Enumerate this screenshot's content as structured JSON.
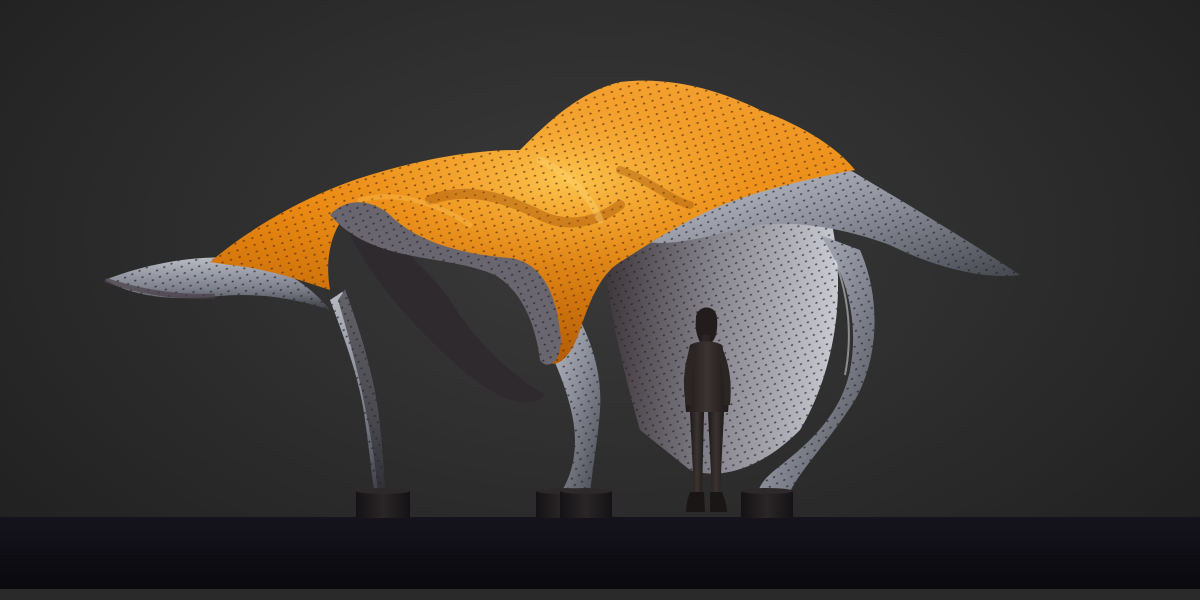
{
  "scene": {
    "subject": "sculpture-render",
    "colors": {
      "background": "#2e2e2e",
      "ground": "#0e0d14",
      "canopy_orange": "#e8860f",
      "canopy_highlight": "#f7a93a",
      "canopy_shadow": "#a85608",
      "metal_light": "#a9acb6",
      "metal_dark": "#4b4d58",
      "pedestal": "#1c1a1d",
      "figure": "#2a2524"
    },
    "pedestals_count": 4,
    "has_human_scale_figure": true
  }
}
